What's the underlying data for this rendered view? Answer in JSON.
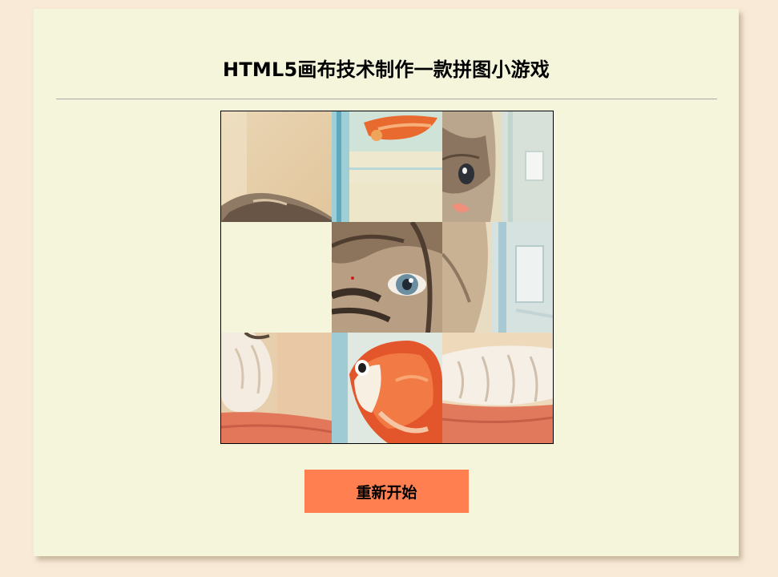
{
  "title": "HTML5画布技术制作一款拼图小游戏",
  "restart_label": "重新开始",
  "colors": {
    "page_background": "#f8ead7",
    "panel_background": "#f5f5dc",
    "button_background": "#ff7f50",
    "board_border": "#000000"
  },
  "puzzle": {
    "grid_size": 3,
    "empty_cell": "row-2-col-1",
    "tiles": [
      {
        "position": "r1c1",
        "depicts": "cat-ear-wall"
      },
      {
        "position": "r1c2",
        "depicts": "goldfish-tail-tank"
      },
      {
        "position": "r1c3",
        "depicts": "kitten-face-right"
      },
      {
        "position": "r2c1",
        "depicts": "empty"
      },
      {
        "position": "r2c2",
        "depicts": "kitten-eye-closeup"
      },
      {
        "position": "r2c3",
        "depicts": "kitten-cheek-glass"
      },
      {
        "position": "r3c1",
        "depicts": "cat-paw-left"
      },
      {
        "position": "r3c2",
        "depicts": "goldfish-head"
      },
      {
        "position": "r3c3",
        "depicts": "cat-paw-right-towel"
      }
    ]
  }
}
